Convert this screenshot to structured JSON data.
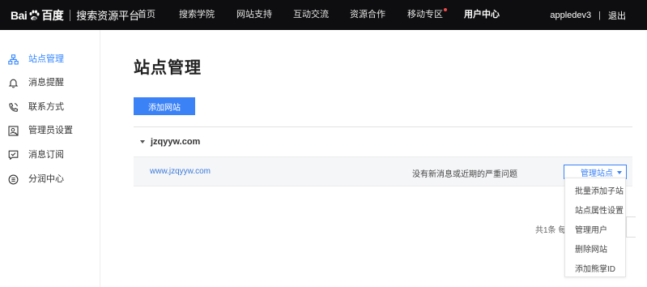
{
  "header": {
    "logo_brand": "Bai百度",
    "logo_product": "搜索资源平台",
    "nav": [
      {
        "label": "首页",
        "active": false,
        "dot": false
      },
      {
        "label": "搜索学院",
        "active": false,
        "dot": false
      },
      {
        "label": "网站支持",
        "active": false,
        "dot": false
      },
      {
        "label": "互动交流",
        "active": false,
        "dot": false
      },
      {
        "label": "资源合作",
        "active": false,
        "dot": false
      },
      {
        "label": "移动专区",
        "active": false,
        "dot": true
      },
      {
        "label": "用户中心",
        "active": true,
        "dot": false
      }
    ],
    "username": "appledev3",
    "separator": "|",
    "logout": "退出"
  },
  "sidebar": {
    "items": [
      {
        "label": "站点管理",
        "icon": "sitemap-icon",
        "active": true
      },
      {
        "label": "消息提醒",
        "icon": "bell-icon",
        "active": false
      },
      {
        "label": "联系方式",
        "icon": "phone-icon",
        "active": false
      },
      {
        "label": "管理员设置",
        "icon": "admin-icon",
        "active": false
      },
      {
        "label": "消息订阅",
        "icon": "subscribe-icon",
        "active": false
      },
      {
        "label": "分润中心",
        "icon": "revenue-icon",
        "active": false
      }
    ]
  },
  "main": {
    "title": "站点管理",
    "add_button": "添加网站",
    "group": {
      "domain": "jzqyyw.com",
      "site": {
        "url": "www.jzqyyw.com",
        "message": "没有新消息或近期的严重问题",
        "manage_button": "管理站点"
      }
    },
    "dropdown": [
      "批量添加子站",
      "站点属性设置",
      "管理用户",
      "删除网站",
      "添加熊掌ID"
    ],
    "pager_text": "共1条  每"
  },
  "colors": {
    "accent": "#3b82f6",
    "topbar": "#0e0e10",
    "link": "#3a7ad9",
    "notify_dot": "#f04b4b"
  }
}
